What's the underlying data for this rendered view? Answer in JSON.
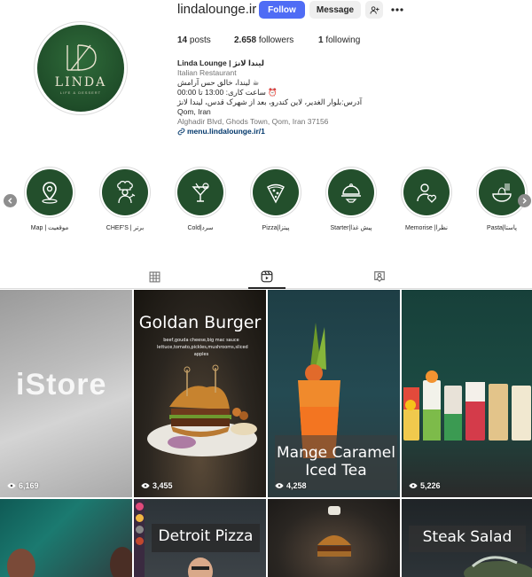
{
  "profile": {
    "username": "lindalounge.ir",
    "follow_label": "Follow",
    "message_label": "Message",
    "avatar_brand": "LINDA",
    "avatar_tagline": "LIFE & DESSERT",
    "stats": {
      "posts_count": "14",
      "posts_label": "posts",
      "followers_count": "2.658",
      "followers_label": "followers",
      "following_count": "1",
      "following_label": "following"
    },
    "bio": {
      "name": "Linda Lounge | لیندا لانژ",
      "category": "Italian Restaurant",
      "line1": "☕ لیندا، خالق حس آرامش",
      "line2": "⏰ ساعت کاری: 13:00 تا 00:00",
      "line3": "آدرس:بلوار الغدیر، لاین کندرو، بعد از شهرک قدس، لیندا لانژ",
      "location": "Qom, Iran",
      "address": "Alghadir Blvd, Ghods Town, Qom, Iran 37156",
      "link": "menu.lindalounge.ir/1"
    }
  },
  "highlights": [
    {
      "label": "Map | موقعیت",
      "icon": "map-pin-icon"
    },
    {
      "label": "CHEF'S | برتر",
      "icon": "chef-icon"
    },
    {
      "label": "Cold|سرد",
      "icon": "cocktail-icon"
    },
    {
      "label": "Pizza|پیتزا",
      "icon": "pizza-icon"
    },
    {
      "label": "Starter|پیش غذا",
      "icon": "cloche-icon"
    },
    {
      "label": "Memorise |نظرا",
      "icon": "person-heart-icon"
    },
    {
      "label": "Pasta|پاستا",
      "icon": "pasta-icon"
    }
  ],
  "tabs": [
    {
      "name": "posts",
      "icon": "grid-icon",
      "active": false
    },
    {
      "name": "reels",
      "icon": "reels-icon",
      "active": true
    },
    {
      "name": "tagged",
      "icon": "tagged-icon",
      "active": false
    }
  ],
  "reels": [
    {
      "title": "",
      "overlay_text": "iStore",
      "views": "6,169"
    },
    {
      "title": "Goldan Burger",
      "subtitle": "beef,gouda cheese,big mac sauce lettuce,tomato,pickles,mushrooms,sliced apples",
      "views": "3,455"
    },
    {
      "title": "Mange Caramel Iced Tea",
      "views": "4,258"
    },
    {
      "title": "",
      "views": "5,226"
    },
    {
      "title": "",
      "views": ""
    },
    {
      "title": "Detroit Pizza",
      "views": ""
    },
    {
      "title": "",
      "views": ""
    },
    {
      "title": "Steak Salad",
      "views": ""
    }
  ],
  "colors": {
    "follow_button": "#4f6cf5",
    "highlight_bg": "#234f2c",
    "link": "#00376b"
  }
}
